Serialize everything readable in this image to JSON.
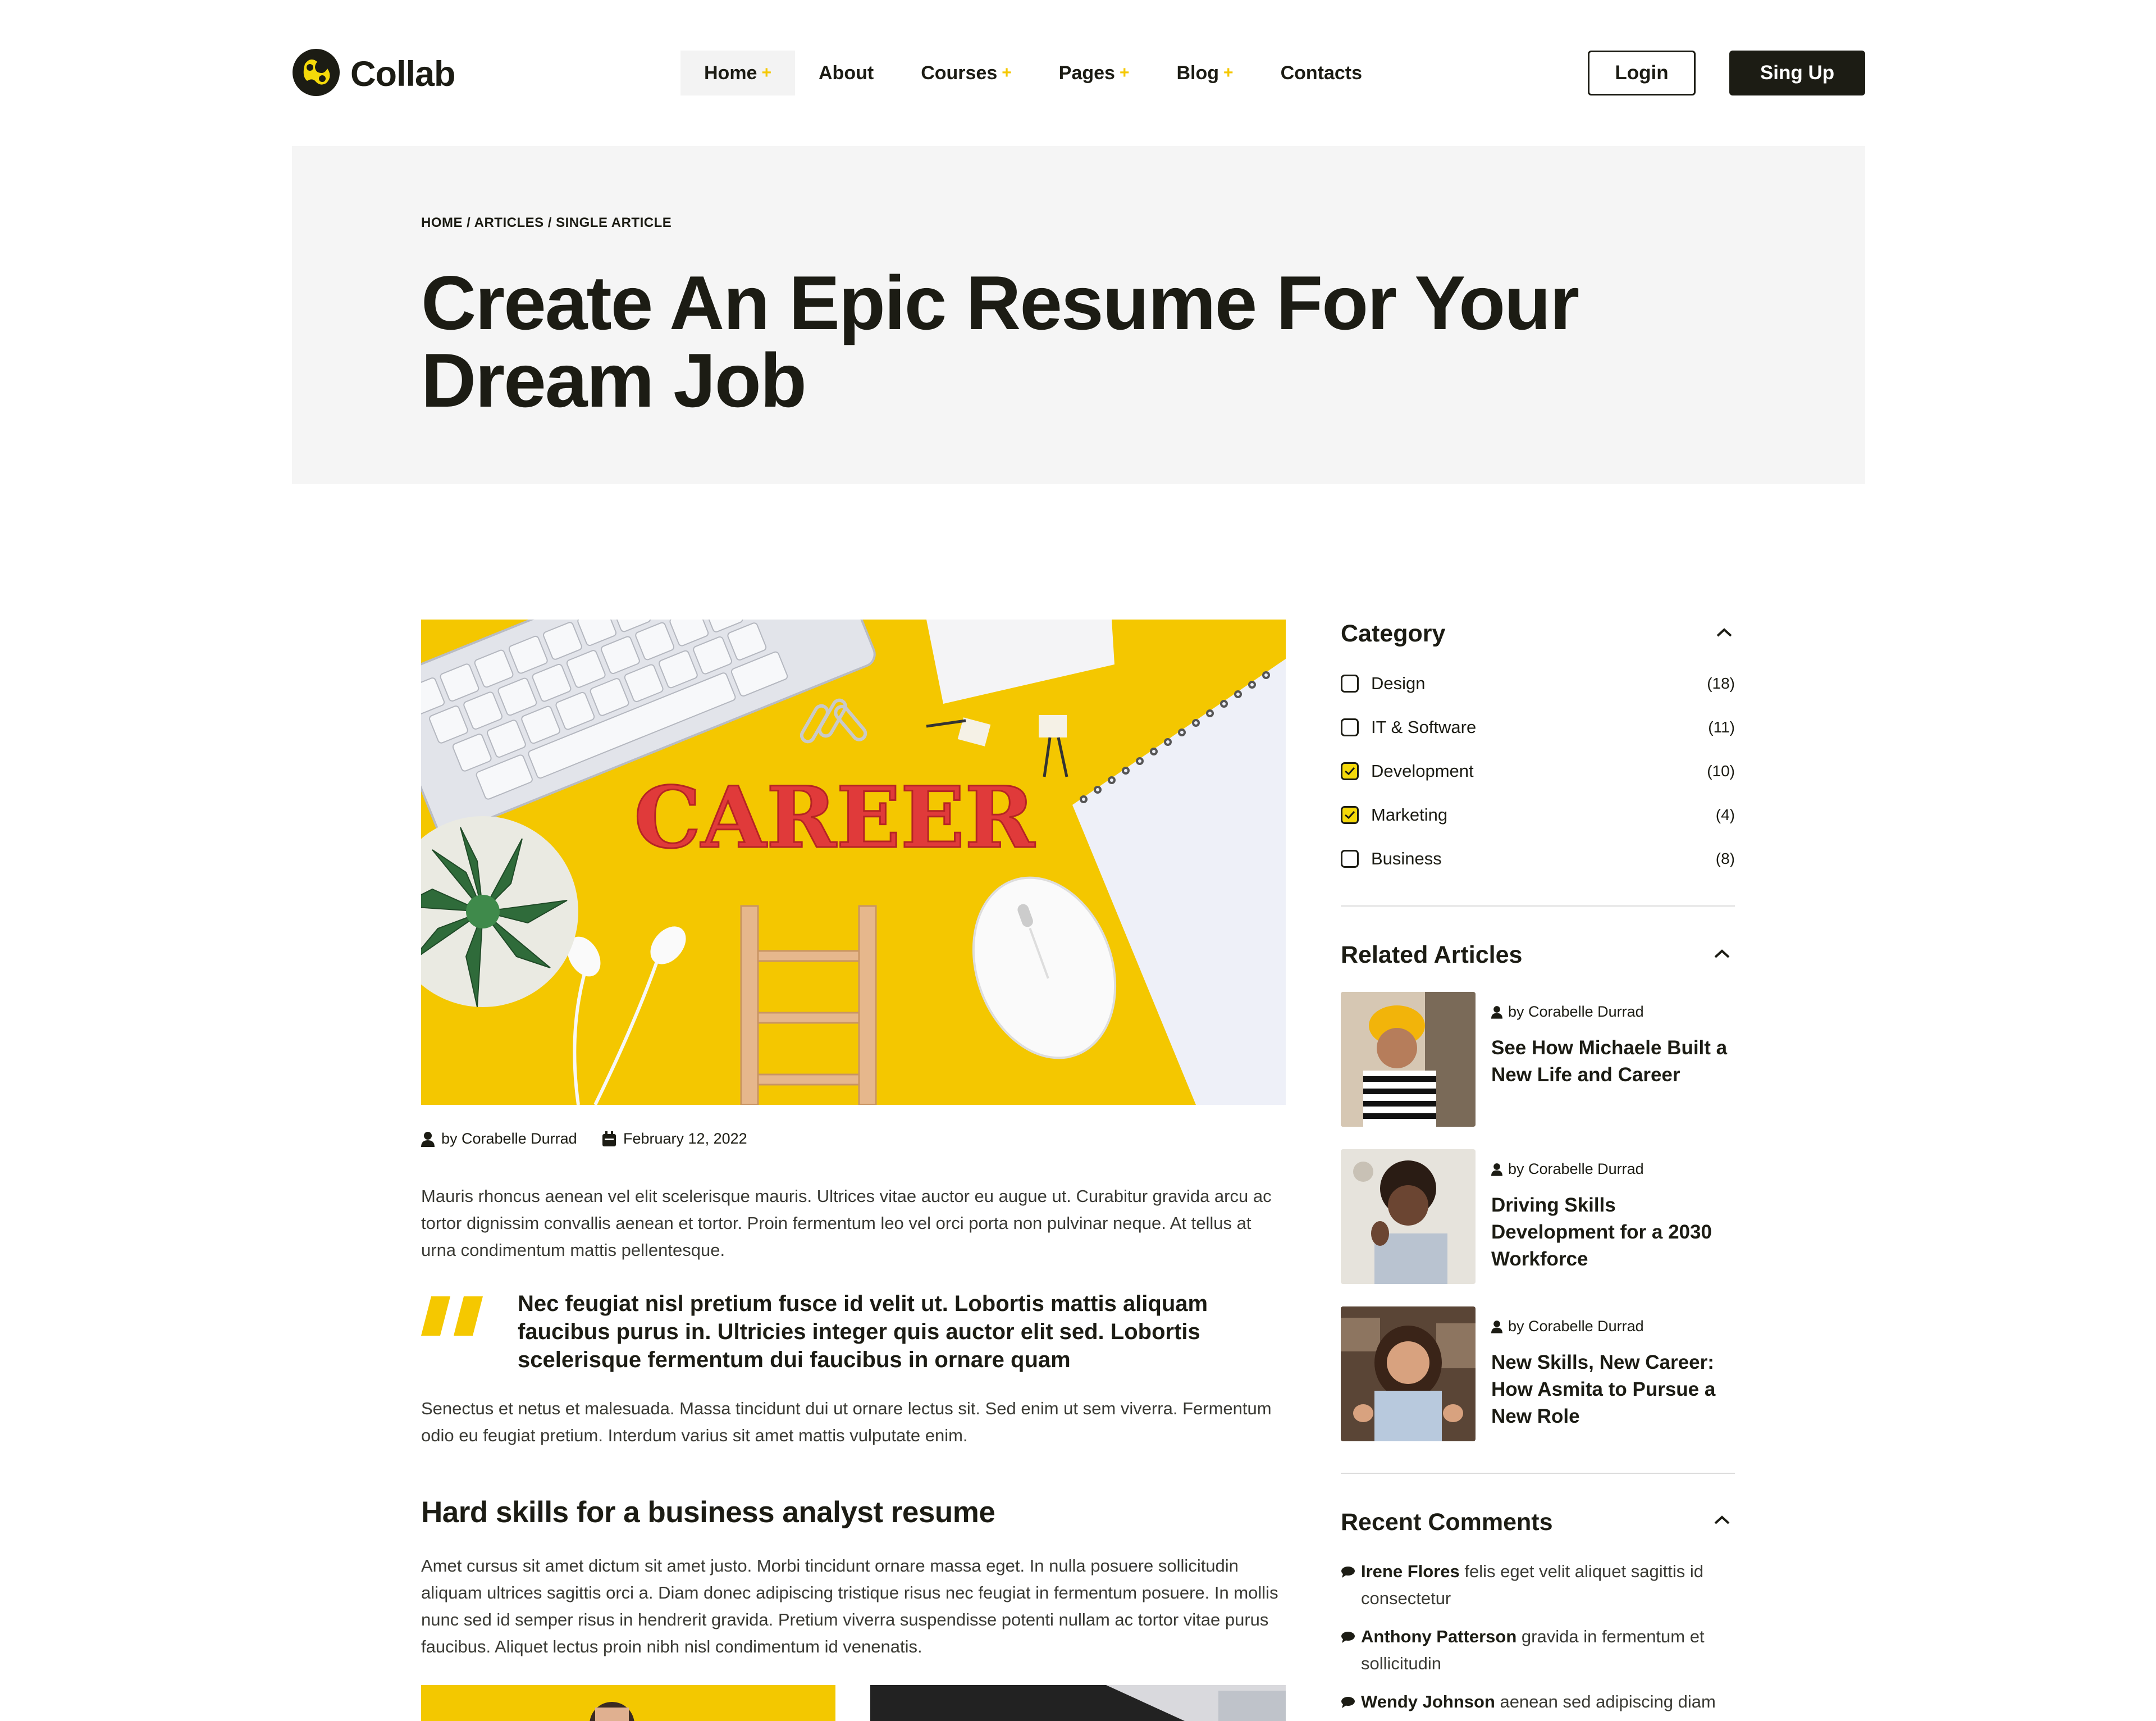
{
  "header": {
    "brand": "Collab",
    "nav": [
      {
        "label": "Home",
        "has_plus": true
      },
      {
        "label": "About",
        "has_plus": false
      },
      {
        "label": "Courses",
        "has_plus": true
      },
      {
        "label": "Pages",
        "has_plus": true
      },
      {
        "label": "Blog",
        "has_plus": true
      },
      {
        "label": "Contacts",
        "has_plus": false
      }
    ],
    "plus": "+",
    "login": "Login",
    "signup": "Sing Up"
  },
  "hero": {
    "breadcrumb": "HOME / ARTICLES / SINGLE ARTICLE",
    "title_line1": "Create An Epic Resume For Your",
    "title_line2": "Dream Job"
  },
  "article": {
    "image_word": "CAREER",
    "author": "by Corabelle Durrad",
    "date": "February 12, 2022",
    "para1": "Mauris rhoncus aenean vel elit scelerisque mauris. Ultrices vitae auctor eu augue ut. Curabitur gravida arcu ac tortor dignissim convallis aenean et tortor. Proin fermentum leo vel orci porta non pulvinar neque. At tellus at urna condimentum mattis pellentesque.",
    "quote": "Nec feugiat nisl pretium fusce id velit ut. Lobortis mattis aliquam faucibus purus in. Ultricies integer quis auctor elit sed. Lobortis scelerisque fermentum dui faucibus in ornare quam",
    "para2": "Senectus et netus et malesuada. Massa tincidunt dui ut ornare lectus sit. Sed enim ut sem viverra. Fermentum odio eu feugiat pretium. Interdum varius sit amet mattis vulputate enim.",
    "heading": "Hard skills for a business analyst resume",
    "para3": "Amet cursus sit amet dictum sit amet justo. Morbi tincidunt ornare massa eget. In nulla posuere sollicitudin aliquam ultrices sagittis orci a. Diam donec adipiscing tristique risus nec feugiat in fermentum posuere. In mollis nunc sed id semper risus in hendrerit gravida. Pretium viverra suspendisse potenti nullam ac tortor vitae purus faucibus. Aliquet lectus proin nibh nisl condimentum id venenatis."
  },
  "sidebar": {
    "category_title": "Category",
    "categories": [
      {
        "label": "Design",
        "count": "(18)",
        "checked": false
      },
      {
        "label": "IT & Software",
        "count": "(11)",
        "checked": false
      },
      {
        "label": "Development",
        "count": "(10)",
        "checked": true
      },
      {
        "label": "Marketing",
        "count": "(4)",
        "checked": true
      },
      {
        "label": "Business",
        "count": "(8)",
        "checked": false
      }
    ],
    "related_title": "Related Articles",
    "related": [
      {
        "author": "by Corabelle Durrad",
        "title": "See How Michaele Built a New Life and Career"
      },
      {
        "author": "by Corabelle Durrad",
        "title": "Driving Skills Development for a 2030 Workforce"
      },
      {
        "author": "by Corabelle Durrad",
        "title": "New Skills, New Career: How Asmita to Pursue a New Role"
      }
    ],
    "comments_title": "Recent Comments",
    "comments": [
      {
        "name": "Irene Flores",
        "text": "felis eget velit aliquet sagittis id consectetur"
      },
      {
        "name": "Anthony Patterson",
        "text": "gravida in fermentum et sollicitudin"
      },
      {
        "name": "Wendy Johnson",
        "text": "aenean sed adipiscing diam"
      }
    ]
  },
  "colors": {
    "accent": "#f5c800",
    "dark": "#1c1c14",
    "hero_bg": "#f5f5f5"
  }
}
